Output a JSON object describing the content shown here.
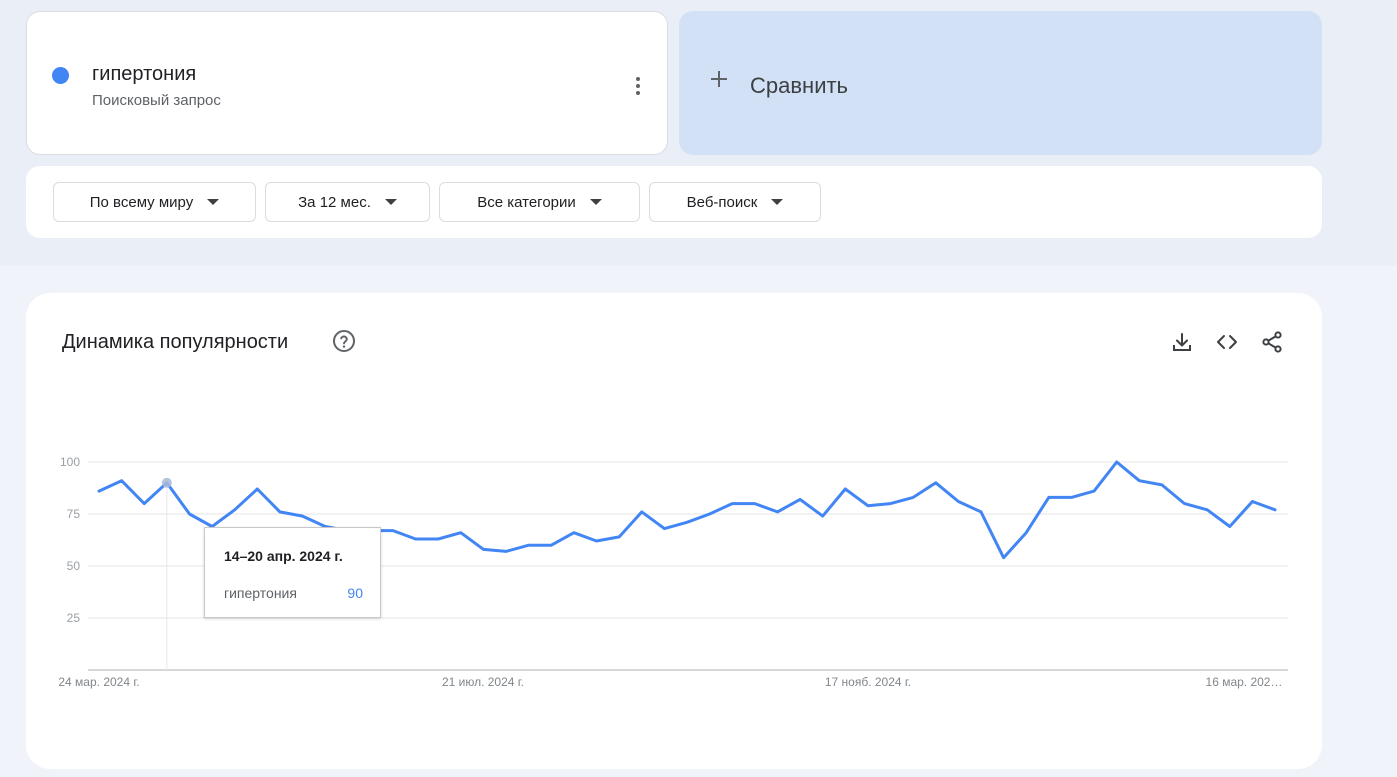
{
  "search_term": {
    "title": "гипертония",
    "subtitle": "Поисковый запрос",
    "color": "#4285f4",
    "more_icon": "more-vert-icon"
  },
  "compare": {
    "label": "Сравнить",
    "icon": "plus-icon"
  },
  "filters": [
    {
      "label": "По всему миру"
    },
    {
      "label": "За 12 мес."
    },
    {
      "label": "Все категории"
    },
    {
      "label": "Веб-поиск"
    }
  ],
  "chart_panel": {
    "title": "Динамика популярности",
    "help_icon": "help-icon",
    "tools": [
      "download-icon",
      "embed-code-icon",
      "share-icon"
    ]
  },
  "tooltip": {
    "date": "14–20 апр. 2024 г.",
    "term": "гипертония",
    "value": "90"
  },
  "chart_data": {
    "type": "line",
    "x_tick_labels": [
      "24 мар. 2024 г.",
      "21 июл. 2024 г.",
      "17 нояб. 2024 г.",
      "16 мар. 202…"
    ],
    "y_ticks": [
      25,
      50,
      75,
      100
    ],
    "ylim": [
      0,
      100
    ],
    "grid": true,
    "highlight_index": 3,
    "series": [
      {
        "name": "гипертония",
        "color": "#4285f4",
        "values": [
          86,
          91,
          80,
          90,
          75,
          69,
          77,
          87,
          76,
          74,
          69,
          67,
          67,
          67,
          63,
          63,
          66,
          58,
          57,
          60,
          60,
          66,
          62,
          64,
          76,
          68,
          71,
          75,
          80,
          80,
          76,
          82,
          74,
          87,
          79,
          80,
          83,
          90,
          81,
          76,
          54,
          66,
          83,
          83,
          86,
          100,
          91,
          89,
          80,
          77,
          69,
          81,
          77
        ]
      }
    ]
  }
}
